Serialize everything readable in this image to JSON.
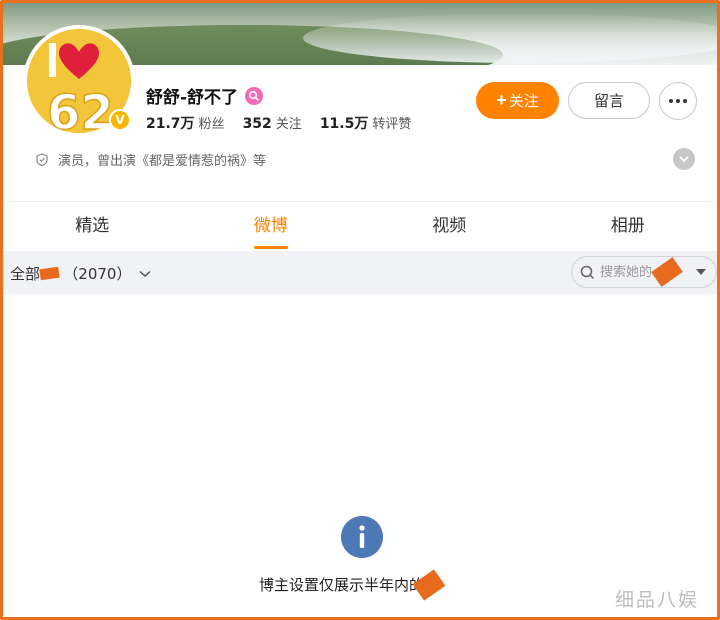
{
  "profile": {
    "name": "舒舒-舒不了",
    "avatar_text": "62",
    "stats": [
      {
        "value": "21.7万",
        "label": "粉丝"
      },
      {
        "value": "352",
        "label": "关注"
      },
      {
        "value": "11.5万",
        "label": "转评赞"
      }
    ],
    "bio": "演员，曾出演《都是爱情惹的祸》等"
  },
  "actions": {
    "follow_plus": "+",
    "follow_label": "关注",
    "message_label": "留言"
  },
  "tabs": [
    {
      "label": "精选",
      "active": false
    },
    {
      "label": "微博",
      "active": true
    },
    {
      "label": "视频",
      "active": false
    },
    {
      "label": "相册",
      "active": false
    }
  ],
  "filter": {
    "prefix": "全部",
    "count": "（2070）"
  },
  "search": {
    "placeholder": "搜索她的"
  },
  "empty_state": {
    "message": "博主设置仅展示半年内的"
  },
  "watermark": "细品八娱",
  "colors": {
    "accent": "#ff8200",
    "info": "#4d79b7",
    "frame": "#e8701f"
  }
}
